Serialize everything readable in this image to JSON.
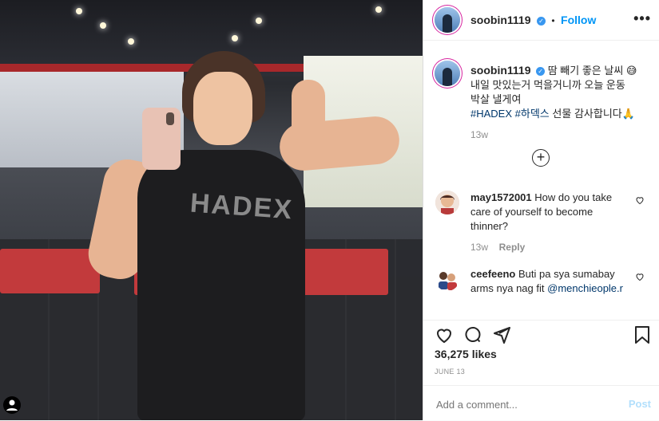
{
  "post": {
    "username": "soobin1119",
    "follow_label": "Follow",
    "more_label": "•••",
    "caption_line1": "땀 빼기 좋은 날씨 😅",
    "caption_line2": "내일 맛있는거 먹을거니까 오늘 운동",
    "caption_line3": "박살 낼게여",
    "hashtag1": "#HADEX",
    "hashtag2": "#하덱스",
    "caption_tail": "선물 감사합니다🙏",
    "caption_time": "13w",
    "load_more_label": "+",
    "photo_text": "HADEX"
  },
  "comments": [
    {
      "username": "may1572001",
      "text": "How do you take care of yourself to become thinner?",
      "time": "13w",
      "reply": "Reply"
    },
    {
      "username": "ceefeeno",
      "text": "Buti pa sya sumabay arms nya nag fit",
      "mention": "@menchieople.r"
    }
  ],
  "actions": {
    "likes": "36,275 likes",
    "date": "JUNE 13"
  },
  "composer": {
    "placeholder": "Add a comment...",
    "post_label": "Post"
  },
  "colors": {
    "accent_blue": "#0095f6",
    "verified_blue": "#3897f0",
    "hashtag": "#00376b"
  },
  "icons": [
    "verified-icon",
    "more-icon",
    "add-icon",
    "heart-icon",
    "comment-icon",
    "share-icon",
    "bookmark-icon",
    "profile-icon"
  ]
}
